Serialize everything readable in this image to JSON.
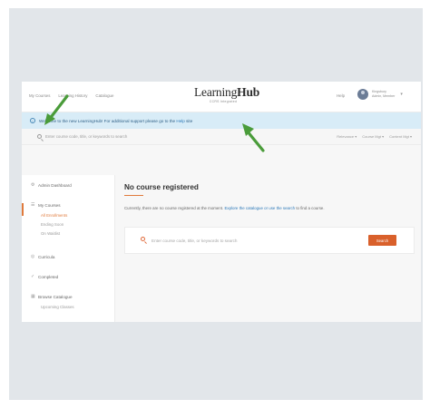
{
  "header": {
    "nav": [
      "My Courses",
      "Learning History",
      "Catalogue"
    ],
    "logo_main_a": "Learning",
    "logo_main_b": "Hub",
    "logo_sub": "CCRS Integrated",
    "help": "Help",
    "user_line1": "Kingsbury",
    "user_line2": "Admin, Member",
    "user_caret": "▾"
  },
  "banner": {
    "prefix": "Welcome to the new LearningHub!",
    "middle": " For additional support please go to the ",
    "link": "Help",
    "suffix": " site"
  },
  "filterbar": {
    "search_placeholder": "Enter course code, title, or keywords to search",
    "filters": [
      "Relevance ▾",
      "Course Mgt ▾",
      "Content Mgt ▾"
    ]
  },
  "sidebar": {
    "items": [
      {
        "icon": "⚙",
        "label": "Admin Dashboard"
      },
      {
        "icon": "☰",
        "label": "My Courses"
      },
      {
        "icon": "◎",
        "label": "Curricula"
      },
      {
        "icon": "✓",
        "label": "Completed"
      },
      {
        "icon": "▦",
        "label": "Browse Catalogue"
      }
    ],
    "my_courses_sub": [
      "All Enrollments",
      "Ending Soon",
      "On Waitlist"
    ],
    "browse_sub": [
      "Upcoming Classes"
    ]
  },
  "main": {
    "title": "No course registered",
    "desc_prefix": "Currently, there are no course registered at the moment. ",
    "desc_link": "Explore the catalogue or use the search",
    "desc_suffix": " to find a course.",
    "search_placeholder": "Enter course code, title, or keywords to search",
    "search_button": "Search"
  },
  "colors": {
    "accent": "#e07a3c",
    "button": "#d9602b",
    "banner": "#d8ecf7",
    "link": "#2b78b8",
    "arrow": "#4a9c3a"
  }
}
